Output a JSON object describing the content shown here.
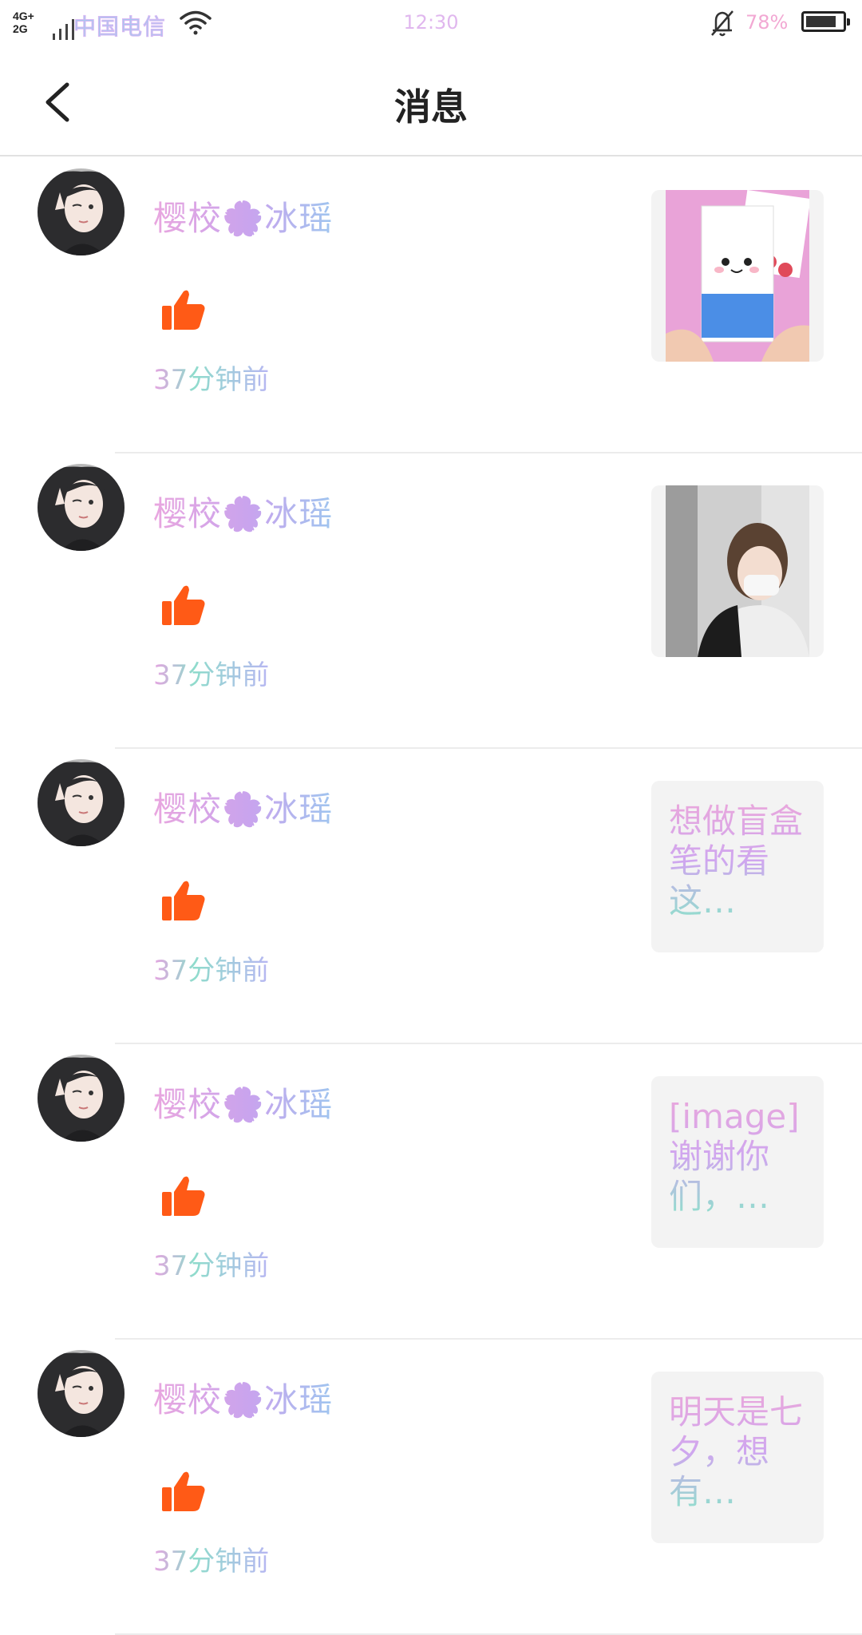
{
  "status_bar": {
    "network_top": "4G+",
    "network_bottom": "2G",
    "carrier": "中国电信",
    "time": "12:30",
    "battery_pct": "78%",
    "battery_level": 0.78
  },
  "header": {
    "title": "消息"
  },
  "messages": [
    {
      "user": "樱校🌸冰瑶",
      "time": "37分钟前",
      "preview_type": "image",
      "preview_text": "",
      "preview_icon": "milk-box-craft-image"
    },
    {
      "user": "樱校🌸冰瑶",
      "time": "37分钟前",
      "preview_type": "image",
      "preview_text": "",
      "preview_icon": "girl-with-mask-image"
    },
    {
      "user": "樱校🌸冰瑶",
      "time": "37分钟前",
      "preview_type": "text",
      "preview_text": "想做盲盒笔的看这…"
    },
    {
      "user": "樱校🌸冰瑶",
      "time": "37分钟前",
      "preview_type": "text",
      "preview_text": "[image]谢谢你们，…"
    },
    {
      "user": "樱校🌸冰瑶",
      "time": "37分钟前",
      "preview_type": "text",
      "preview_text": "明天是七夕，想有…"
    }
  ],
  "colors": {
    "like_icon": "#ff5a16",
    "name_gradient_start": "#e9a6df",
    "name_gradient_end": "#9fc5ef"
  }
}
